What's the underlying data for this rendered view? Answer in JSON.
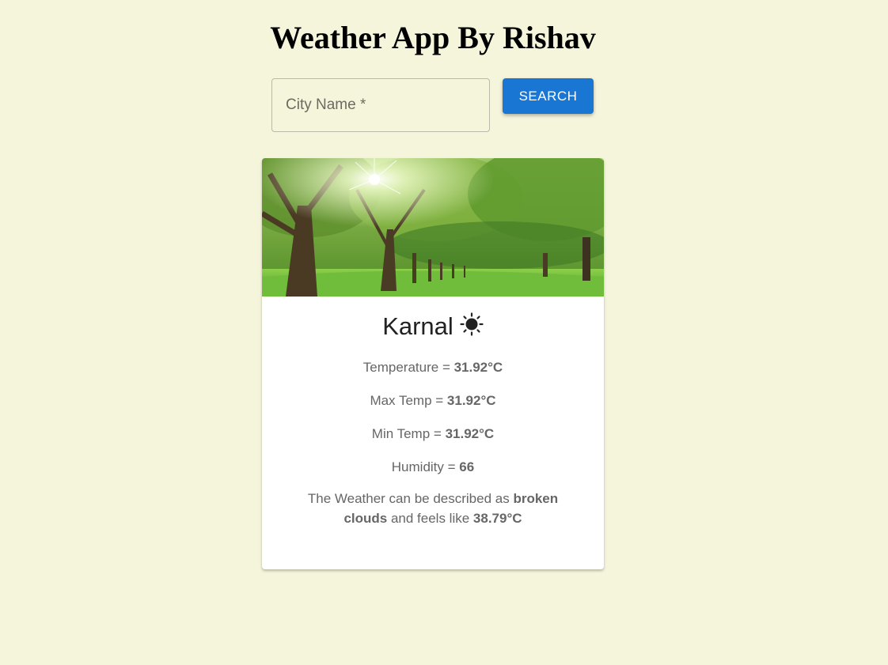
{
  "header": {
    "title": "Weather App By Rishav"
  },
  "search": {
    "placeholder": "City Name *",
    "button_label": "SEARCH"
  },
  "card": {
    "city": "Karnal",
    "weather_icon": "sun-icon",
    "temperature_label": "Temperature = ",
    "temperature_value": "31.92°C",
    "max_temp_label": "Max Temp = ",
    "max_temp_value": "31.92°C",
    "min_temp_label": "Min Temp = ",
    "min_temp_value": "31.92°C",
    "humidity_label": "Humidity = ",
    "humidity_value": "66",
    "desc_prefix": "The Weather can be described as ",
    "desc_condition": "broken clouds",
    "desc_middle": " and feels like ",
    "desc_feels_like": "38.79°C"
  },
  "colors": {
    "background": "#f5f5dc",
    "accent": "#1976d2"
  }
}
